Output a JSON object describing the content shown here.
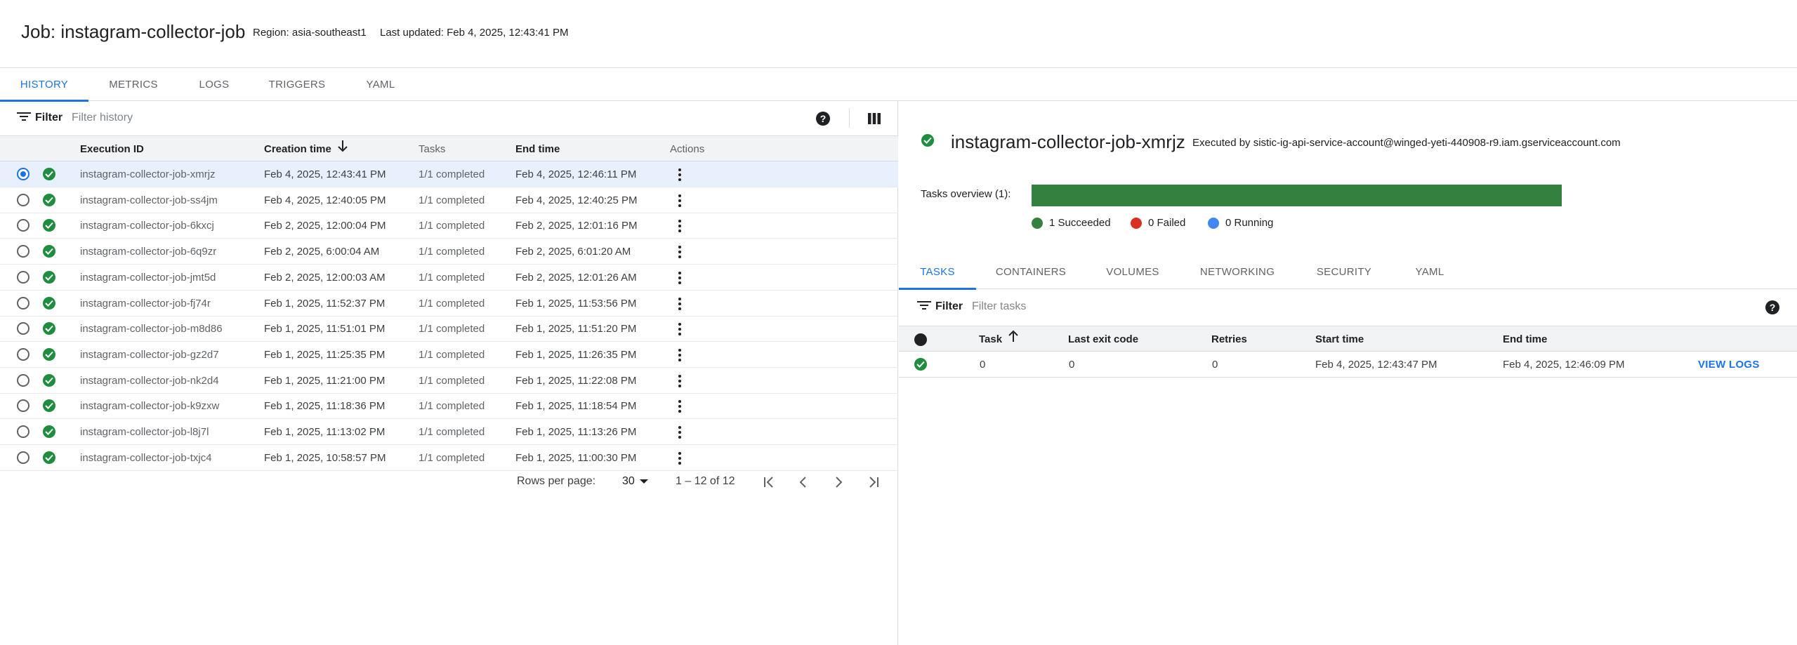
{
  "header": {
    "title": "Job: instagram-collector-job",
    "region": "Region: asia-southeast1",
    "last_updated": "Last updated: Feb 4, 2025, 12:43:41 PM"
  },
  "main_tabs": [
    {
      "label": "HISTORY",
      "active": true
    },
    {
      "label": "METRICS",
      "active": false
    },
    {
      "label": "LOGS",
      "active": false
    },
    {
      "label": "TRIGGERS",
      "active": false
    },
    {
      "label": "YAML",
      "active": false
    }
  ],
  "history": {
    "filter_label": "Filter",
    "filter_placeholder": "Filter history",
    "columns": {
      "execution_id": "Execution ID",
      "creation_time": "Creation time",
      "tasks": "Tasks",
      "end_time": "End time",
      "actions": "Actions"
    },
    "rows": [
      {
        "id": "instagram-collector-job-xmrjz",
        "created": "Feb 4, 2025, 12:43:41 PM",
        "tasks": "1/1 completed",
        "end": "Feb 4, 2025, 12:46:11 PM",
        "selected": true
      },
      {
        "id": "instagram-collector-job-ss4jm",
        "created": "Feb 4, 2025, 12:40:05 PM",
        "tasks": "1/1 completed",
        "end": "Feb 4, 2025, 12:40:25 PM",
        "selected": false
      },
      {
        "id": "instagram-collector-job-6kxcj",
        "created": "Feb 2, 2025, 12:00:04 PM",
        "tasks": "1/1 completed",
        "end": "Feb 2, 2025, 12:01:16 PM",
        "selected": false
      },
      {
        "id": "instagram-collector-job-6q9zr",
        "created": "Feb 2, 2025, 6:00:04 AM",
        "tasks": "1/1 completed",
        "end": "Feb 2, 2025, 6:01:20 AM",
        "selected": false
      },
      {
        "id": "instagram-collector-job-jmt5d",
        "created": "Feb 2, 2025, 12:00:03 AM",
        "tasks": "1/1 completed",
        "end": "Feb 2, 2025, 12:01:26 AM",
        "selected": false
      },
      {
        "id": "instagram-collector-job-fj74r",
        "created": "Feb 1, 2025, 11:52:37 PM",
        "tasks": "1/1 completed",
        "end": "Feb 1, 2025, 11:53:56 PM",
        "selected": false
      },
      {
        "id": "instagram-collector-job-m8d86",
        "created": "Feb 1, 2025, 11:51:01 PM",
        "tasks": "1/1 completed",
        "end": "Feb 1, 2025, 11:51:20 PM",
        "selected": false
      },
      {
        "id": "instagram-collector-job-gz2d7",
        "created": "Feb 1, 2025, 11:25:35 PM",
        "tasks": "1/1 completed",
        "end": "Feb 1, 2025, 11:26:35 PM",
        "selected": false
      },
      {
        "id": "instagram-collector-job-nk2d4",
        "created": "Feb 1, 2025, 11:21:00 PM",
        "tasks": "1/1 completed",
        "end": "Feb 1, 2025, 11:22:08 PM",
        "selected": false
      },
      {
        "id": "instagram-collector-job-k9zxw",
        "created": "Feb 1, 2025, 11:18:36 PM",
        "tasks": "1/1 completed",
        "end": "Feb 1, 2025, 11:18:54 PM",
        "selected": false
      },
      {
        "id": "instagram-collector-job-l8j7l",
        "created": "Feb 1, 2025, 11:13:02 PM",
        "tasks": "1/1 completed",
        "end": "Feb 1, 2025, 11:13:26 PM",
        "selected": false
      },
      {
        "id": "instagram-collector-job-txjc4",
        "created": "Feb 1, 2025, 10:58:57 PM",
        "tasks": "1/1 completed",
        "end": "Feb 1, 2025, 11:00:30 PM",
        "selected": false
      }
    ],
    "pagination": {
      "rows_per_page_label": "Rows per page:",
      "rows_per_page": "30",
      "range": "1 – 12 of 12"
    }
  },
  "execution": {
    "name": "instagram-collector-job-xmrjz",
    "executed_by": "Executed by sistic-ig-api-service-account@winged-yeti-440908-r9.iam.gserviceaccount.com",
    "tasks_overview_label": "Tasks overview (1):",
    "succeeded_fraction": 1.0,
    "legend": {
      "succeeded": "1 Succeeded",
      "failed": "0 Failed",
      "running": "0 Running"
    },
    "tabs": [
      {
        "label": "TASKS",
        "active": true
      },
      {
        "label": "CONTAINERS",
        "active": false
      },
      {
        "label": "VOLUMES",
        "active": false
      },
      {
        "label": "NETWORKING",
        "active": false
      },
      {
        "label": "SECURITY",
        "active": false
      },
      {
        "label": "YAML",
        "active": false
      }
    ],
    "filter_label": "Filter",
    "filter_placeholder": "Filter tasks",
    "task_columns": {
      "task": "Task",
      "last_exit_code": "Last exit code",
      "retries": "Retries",
      "start_time": "Start time",
      "end_time": "End time"
    },
    "task_rows": [
      {
        "task": "0",
        "exit_code": "0",
        "retries": "0",
        "start": "Feb 4, 2025, 12:43:47 PM",
        "end": "Feb 4, 2025, 12:46:09 PM",
        "action": "VIEW LOGS"
      }
    ]
  },
  "colors": {
    "accent": "#1a73e8",
    "success": "#1e8e3e",
    "bar_success": "#34813f",
    "failed": "#d93025",
    "running": "#4285f4"
  }
}
